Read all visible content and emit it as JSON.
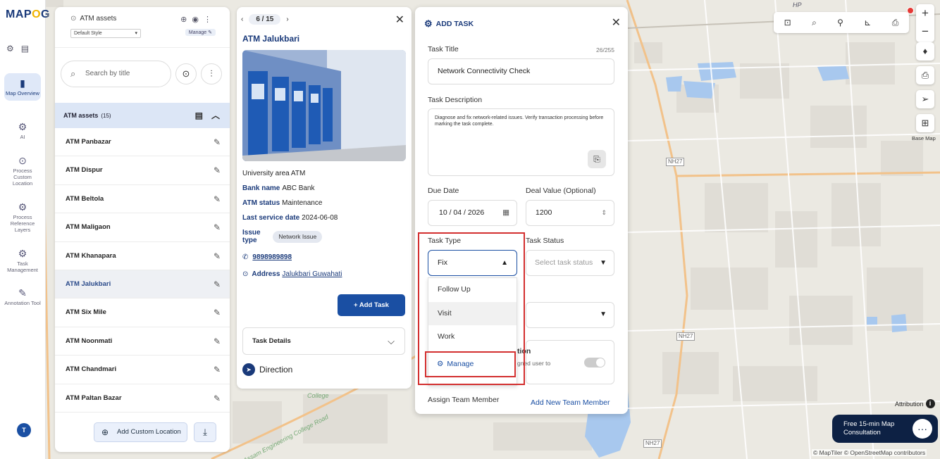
{
  "brand": {
    "logo_left": "MAP",
    "logo_highlight": "O",
    "logo_right": "G"
  },
  "rail": {
    "items": [
      {
        "label": "Map Overview",
        "icon": "map-icon",
        "active": true
      },
      {
        "label": "AI",
        "icon": "ai-icon"
      },
      {
        "label": "Process Custom Location",
        "icon": "location-pin-icon"
      },
      {
        "label": "Process Reference Layers",
        "icon": "layers-icon"
      },
      {
        "label": "Task Management",
        "icon": "task-icon"
      },
      {
        "label": "Annotation Tool",
        "icon": "brush-icon"
      }
    ],
    "avatar": "T"
  },
  "assets": {
    "layer_name": "ATM assets",
    "style": "Default Style",
    "manage": "Manage",
    "search_placeholder": "Search by title",
    "list_title": "ATM assets",
    "list_count": "(15)",
    "items": [
      "ATM Panbazar",
      "ATM Dispur",
      "ATM Beltola",
      "ATM Maligaon",
      "ATM Khanapara",
      "ATM Jalukbari",
      "ATM Six Mile",
      "ATM Noonmati",
      "ATM Chandmari",
      "ATM Paltan Bazar"
    ],
    "add_custom_location": "Add Custom Location"
  },
  "detail": {
    "pager": "6 / 15",
    "title": "ATM Jalukbari",
    "area": "University area ATM",
    "bank_label": "Bank name",
    "bank": "ABC Bank",
    "status_label": "ATM status",
    "status": "Maintenance",
    "service_label": "Last service date",
    "service": "2024-06-08",
    "issue_label_1": "Issue",
    "issue_label_2": "type",
    "issue": "Network Issue",
    "phone": "9898989898",
    "address_label": "Address",
    "address": "Jalukbari Guwahati",
    "add_task": "+ Add Task",
    "task_details": "Task Details",
    "direction": "Direction"
  },
  "task": {
    "header": "ADD TASK",
    "title_label": "Task Title",
    "title_counter": "26/255",
    "title_value": "Network Connectivity Check",
    "desc_label": "Task Description",
    "desc_value": "Diagnose and fix network-related issues. Verify transaction processing before marking the task complete.",
    "due_label": "Due Date",
    "due_value": "10 / 04 / 2026",
    "deal_label": "Deal Value (Optional)",
    "deal_value": "1200",
    "type_label": "Task Type",
    "type_value": "Fix",
    "status_label": "Task Status",
    "status_placeholder": "Select task status",
    "type_options": [
      "Follow Up",
      "Visit",
      "Work"
    ],
    "manage_option": "Manage",
    "notify_partial_1": "tion",
    "notify_partial_2": "gned user to",
    "assign_label": "Assign Team Member",
    "add_member": "Add New Team Member"
  },
  "map": {
    "roads": [
      "NH27",
      "NH27",
      "NH27"
    ],
    "places": [
      "Assam Engineering College Road",
      "College",
      "HP"
    ],
    "basemap_label": "Base Map",
    "attribution": "Attribution",
    "consult_1": "Free 15-min Map",
    "consult_2": "Consultation",
    "credits": "© MapTiler © OpenStreetMap contributors"
  }
}
